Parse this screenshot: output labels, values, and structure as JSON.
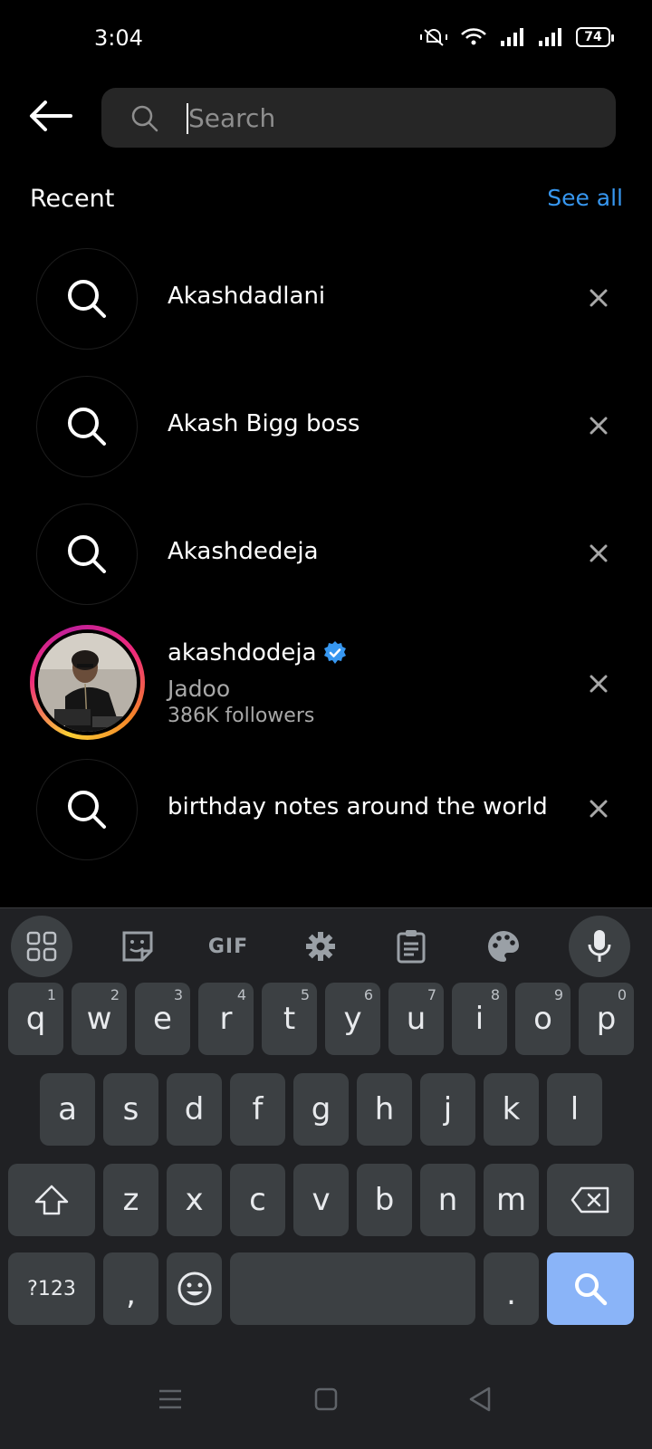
{
  "status_bar": {
    "time": "3:04",
    "battery": "74"
  },
  "search": {
    "placeholder": "Search",
    "value": ""
  },
  "recent": {
    "title": "Recent",
    "see_all": "See all",
    "items": [
      {
        "type": "query",
        "label": "Akashdadlani"
      },
      {
        "type": "query",
        "label": "Akash Bigg boss"
      },
      {
        "type": "query",
        "label": "Akashdedeja"
      },
      {
        "type": "account",
        "username": "akashdodeja",
        "verified": true,
        "subtitle": "Jadoo",
        "followers": "386K followers"
      },
      {
        "type": "query",
        "label": "birthday notes around the world"
      }
    ]
  },
  "keyboard": {
    "toolbar": {
      "gif_label": "GIF"
    },
    "row1": [
      {
        "key": "q",
        "hint": "1"
      },
      {
        "key": "w",
        "hint": "2"
      },
      {
        "key": "e",
        "hint": "3"
      },
      {
        "key": "r",
        "hint": "4"
      },
      {
        "key": "t",
        "hint": "5"
      },
      {
        "key": "y",
        "hint": "6"
      },
      {
        "key": "u",
        "hint": "7"
      },
      {
        "key": "i",
        "hint": "8"
      },
      {
        "key": "o",
        "hint": "9"
      },
      {
        "key": "p",
        "hint": "0"
      }
    ],
    "row2": [
      "a",
      "s",
      "d",
      "f",
      "g",
      "h",
      "j",
      "k",
      "l"
    ],
    "row3": [
      "z",
      "x",
      "c",
      "v",
      "b",
      "n",
      "m"
    ],
    "symbols_label": "?123",
    "comma": ",",
    "period": "."
  },
  "colors": {
    "accent": "#3797f0",
    "keyboard_bg": "#202124",
    "key_bg": "#3c4043",
    "search_key": "#8ab4f8"
  }
}
